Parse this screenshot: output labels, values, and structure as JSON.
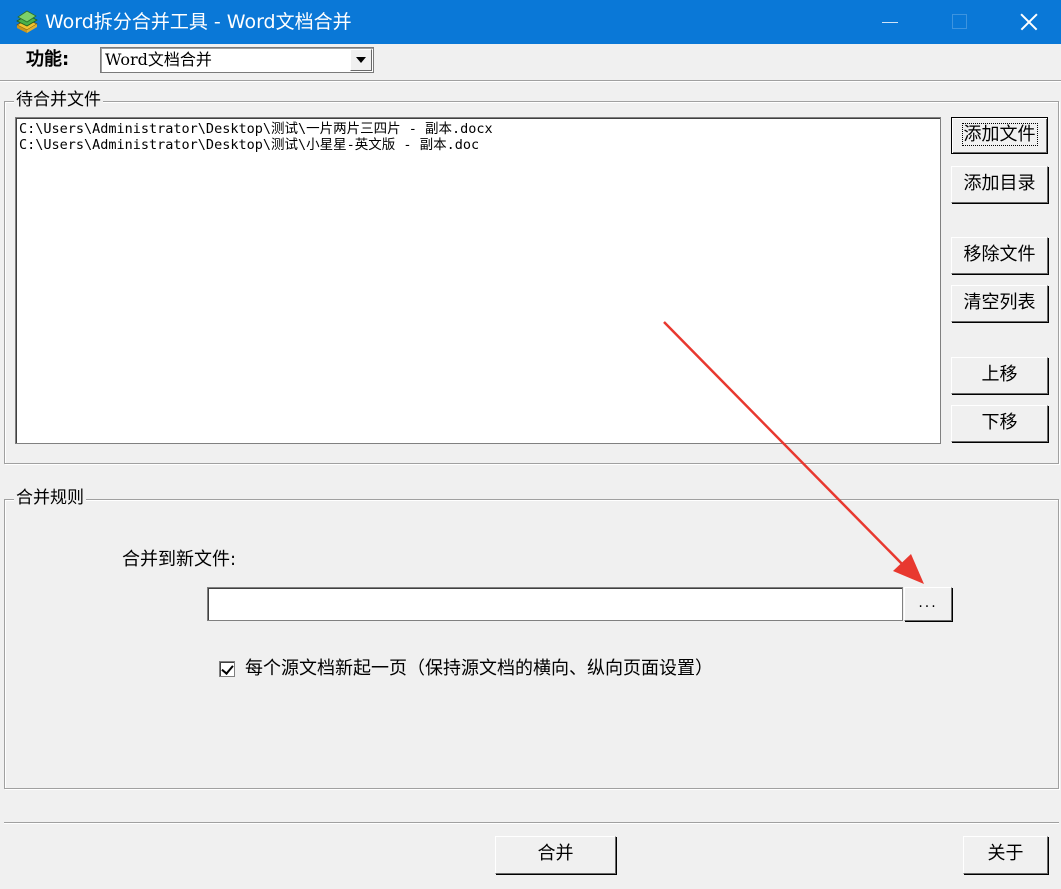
{
  "window": {
    "title": "Word拆分合并工具 - Word文档合并",
    "icon": "book-stack-icon"
  },
  "toolbar": {
    "function_label": "功能:",
    "function_selected": "Word文档合并"
  },
  "pending_files": {
    "legend": "待合并文件",
    "files": [
      "C:\\Users\\Administrator\\Desktop\\测试\\一片两片三四片 - 副本.docx",
      "C:\\Users\\Administrator\\Desktop\\测试\\小星星-英文版 - 副本.doc"
    ],
    "buttons": {
      "add_file": "添加文件",
      "add_directory": "添加目录",
      "remove_file": "移除文件",
      "clear_list": "清空列表",
      "move_up": "上移",
      "move_down": "下移"
    }
  },
  "merge_rules": {
    "legend": "合并规则",
    "output_label": "合并到新文件:",
    "output_value": "",
    "browse_label": "...",
    "new_page_checked": true,
    "new_page_label": "每个源文档新起一页（保持源文档的横向、纵向页面设置）"
  },
  "footer": {
    "merge_button": "合并",
    "about_button": "关于"
  },
  "colors": {
    "titlebar": "#0a78d7",
    "dialog_bg": "#f0f0f0",
    "annotation_arrow": "#e8382f"
  }
}
